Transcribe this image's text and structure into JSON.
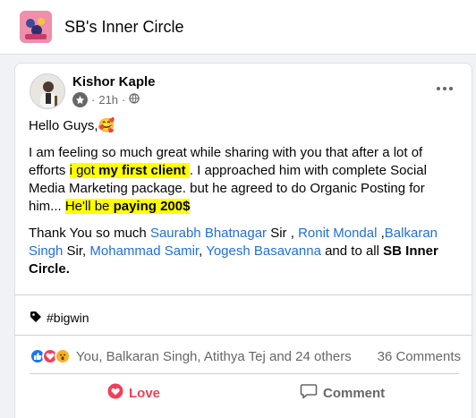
{
  "group": {
    "name": "SB's Inner Circle"
  },
  "post": {
    "author": "Kishor Kaple",
    "time": "21h",
    "greeting": "Hello Guys,",
    "p1": {
      "a": "I am feeling so much great while sharing with you that after a lot of efforts ",
      "hl1a": "i got ",
      "hl1b": "my first client",
      "hl1c": " ",
      "b": ". I approached him with complete Social Media Marketing package. but he agreed to do Organic Posting for him... ",
      "hl2a": "He'll be ",
      "hl2b": "paying 200$"
    },
    "p2": {
      "a": "Thank You so much ",
      "name1": "Saurabh Bhatnagar",
      "b": " Sir , ",
      "name2": "Ronit Mondal",
      "c": " ,",
      "name3": "Balkaran Singh",
      "d": " Sir, ",
      "name4": "Mohammad Samir",
      "e": ", ",
      "name5": "Yogesh Basavanna",
      "f": " and to all ",
      "group_bold": "SB Inner Circle."
    },
    "tag": "#bigwin",
    "reacted_by": "You, Balkaran Singh, Atithya Tej and 24 others",
    "comments_count": "36 Comments",
    "love_label": "Love",
    "comment_label": "Comment"
  },
  "colors": {
    "link": "#216fdb",
    "highlight": "#ffff00",
    "love": "#f33e58",
    "like": "#1877f2",
    "haha": "#f7b125"
  }
}
